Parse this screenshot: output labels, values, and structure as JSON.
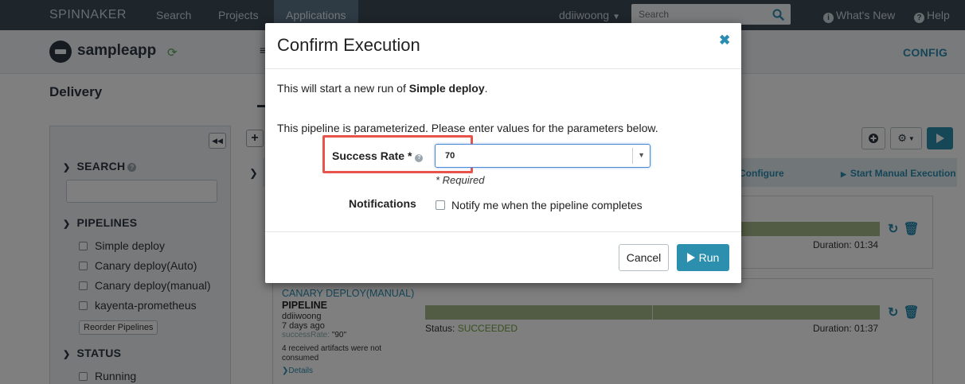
{
  "topnav": {
    "brand": "SPINNAKER",
    "nav_search": "Search",
    "nav_projects": "Projects",
    "nav_applications": "Applications",
    "user": "ddiiwoong",
    "search_placeholder": "Search",
    "whats_new": "What's New",
    "help": "Help"
  },
  "app": {
    "name": "sampleapp",
    "config": "CONFIG",
    "section": "Delivery"
  },
  "sidebar": {
    "search_heading": "SEARCH",
    "pipelines_heading": "PIPELINES",
    "pipelines": [
      "Simple deploy",
      "Canary deploy(Auto)",
      "Canary deploy(manual)",
      "kayenta-prometheus"
    ],
    "reorder_label": "Reorder Pipelines",
    "status_heading": "STATUS",
    "status_items": [
      "Running"
    ]
  },
  "executions": {
    "configure_label": "Configure",
    "start_manual_label": "Start Manual Execution",
    "card1": {
      "duration": "Duration: 01:34"
    },
    "card2": {
      "name": "CANARY DEPLOY(MANUAL)",
      "type": "PIPELINE",
      "user": "ddiiwoong",
      "ago": "7 days ago",
      "param_key": "successRate:",
      "param_value": "\"90\"",
      "artifacts": "4 received artifacts were not consumed",
      "details": "Details",
      "status_label": "Status:",
      "status_value": "SUCCEEDED",
      "duration": "Duration: 01:37"
    }
  },
  "modal": {
    "title": "Confirm Execution",
    "intro_prefix": "This will start a new run of ",
    "pipeline_name": "Simple deploy",
    "intro_suffix": ".",
    "param_text": "This pipeline is parameterized. Please enter values for the parameters below.",
    "success_rate_label": "Success Rate *",
    "success_rate_value": "70",
    "required_note": "* Required",
    "notifications_label": "Notifications",
    "notify_checkbox_label": "Notify me when the pipeline completes",
    "notify_checked": false,
    "cancel_label": "Cancel",
    "run_label": "Run"
  },
  "colors": {
    "topnav_bg": "#3c4b57",
    "accent": "#2c8fae",
    "highlight": "#e8544a",
    "stage_success": "#a5b888"
  }
}
